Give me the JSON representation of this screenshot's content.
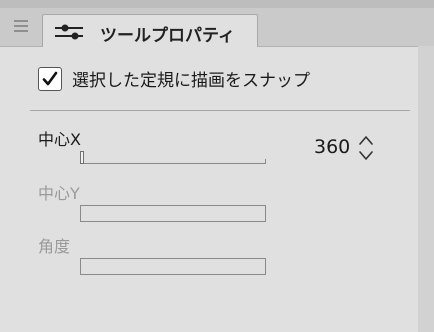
{
  "panel": {
    "tab_title": "ツールプロパティ",
    "tab_icon": "sliders-icon",
    "grip_icon": "panel-menu-icon"
  },
  "snap": {
    "label": "選択した定規に描画をスナップ",
    "checked": true
  },
  "fields": {
    "center_x": {
      "label": "中心X",
      "value": "360",
      "slider_fraction": 0.0,
      "enabled": true
    },
    "center_y": {
      "label": "中心Y",
      "enabled": false
    },
    "angle": {
      "label": "角度",
      "enabled": false
    }
  }
}
